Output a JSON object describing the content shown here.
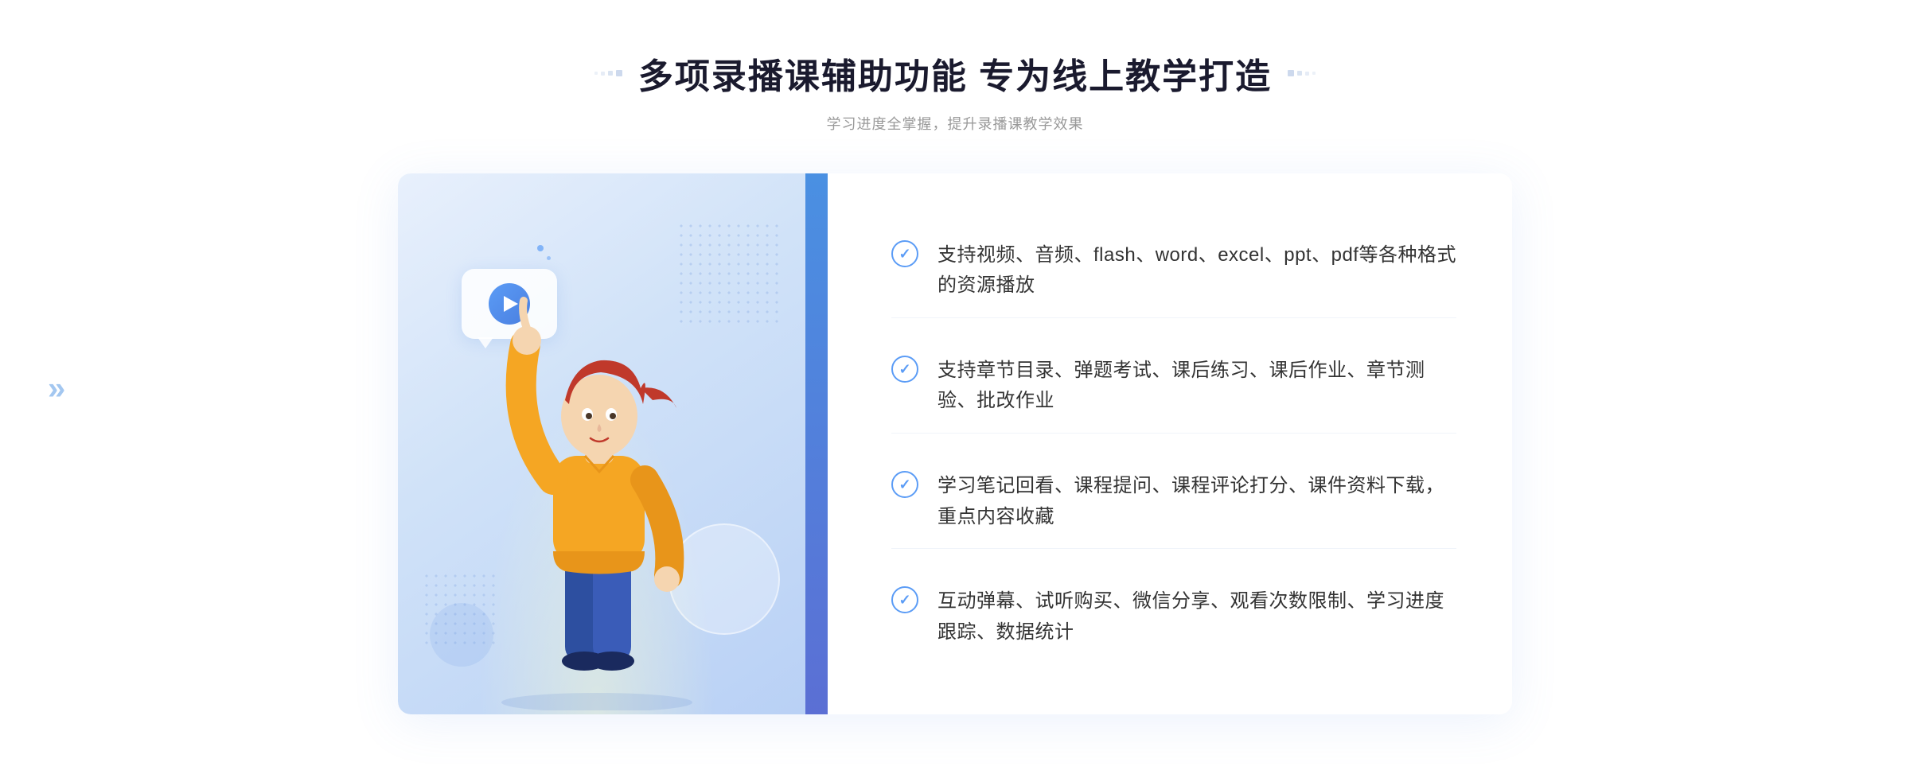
{
  "header": {
    "title": "多项录播课辅助功能 专为线上教学打造",
    "subtitle": "学习进度全掌握，提升录播课教学效果",
    "deco_left": [
      "·",
      "·",
      "·",
      "·"
    ],
    "deco_right": [
      "·",
      "·",
      "·",
      "·"
    ]
  },
  "features": [
    {
      "id": "feature-1",
      "text": "支持视频、音频、flash、word、excel、ppt、pdf等各种格式的资源播放"
    },
    {
      "id": "feature-2",
      "text": "支持章节目录、弹题考试、课后练习、课后作业、章节测验、批改作业"
    },
    {
      "id": "feature-3",
      "text": "学习笔记回看、课程提问、课程评论打分、课件资料下载，重点内容收藏"
    },
    {
      "id": "feature-4",
      "text": "互动弹幕、试听购买、微信分享、观看次数限制、学习进度跟踪、数据统计"
    }
  ],
  "colors": {
    "primary": "#5b9cf6",
    "title": "#1a1a2e",
    "text": "#333333",
    "subtitle": "#999999",
    "bg_light": "#e8f0fc",
    "accent": "#4a90e2"
  },
  "icons": {
    "check": "✓",
    "play": "▶",
    "chevron_right": "»",
    "chevron_left": "«"
  }
}
